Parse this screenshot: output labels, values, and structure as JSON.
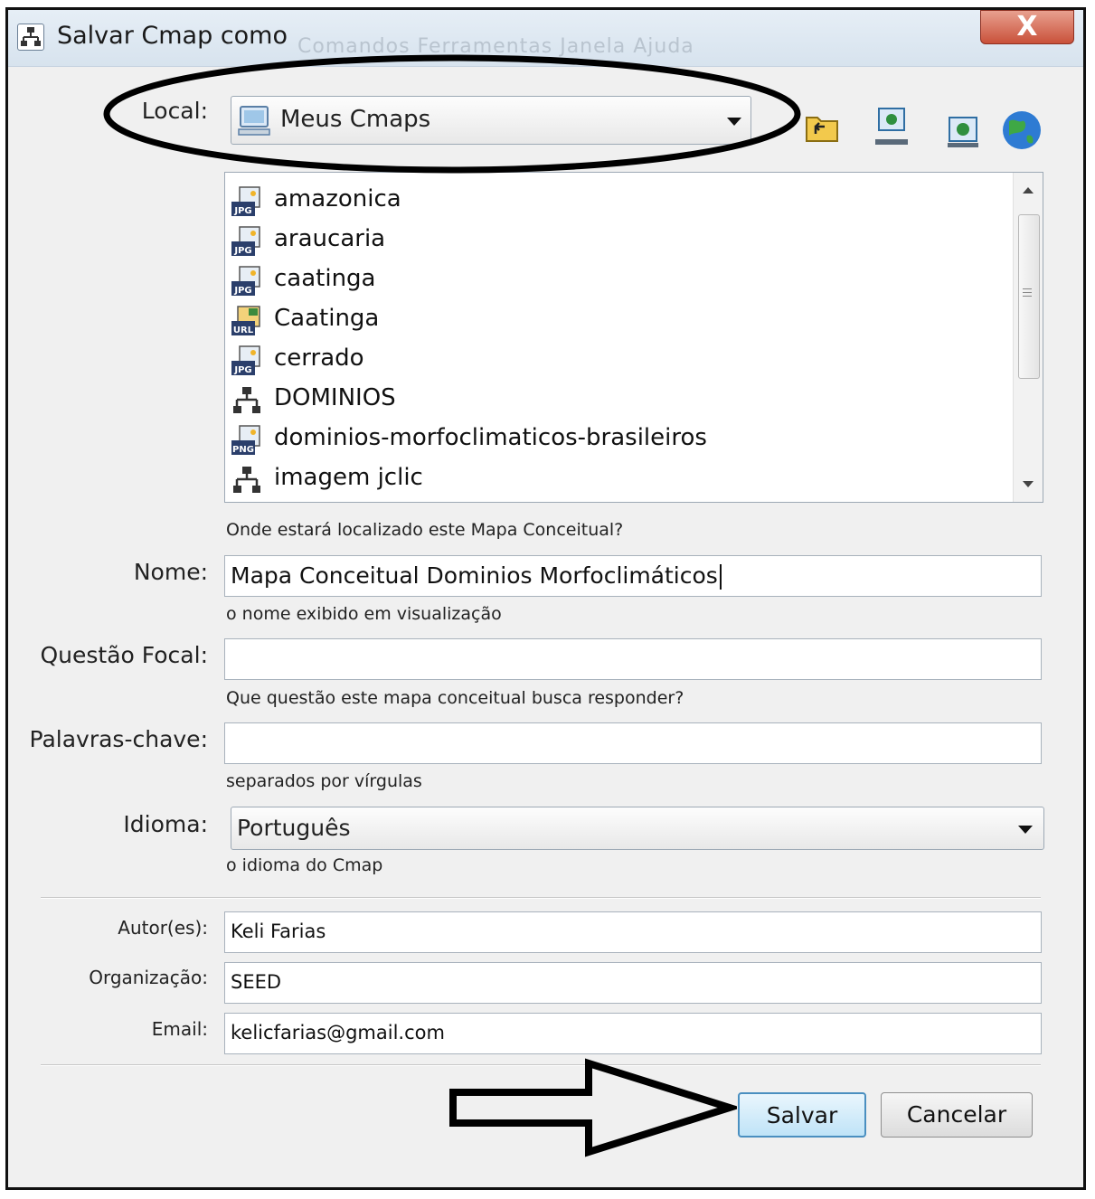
{
  "window": {
    "title": "Salvar Cmap como",
    "close_label": "X",
    "background_menu": "Comandos   Ferramentas   Janela   Ajuda"
  },
  "local": {
    "label": "Local:",
    "selected": "Meus Cmaps",
    "toolbar_icons": [
      "folder-up-icon",
      "computer-icon",
      "network-place-icon",
      "globe-icon"
    ]
  },
  "files": [
    {
      "name": "amazonica",
      "icon": "jpg-icon"
    },
    {
      "name": "araucaria",
      "icon": "jpg-icon"
    },
    {
      "name": "caatinga",
      "icon": "jpg-icon"
    },
    {
      "name": "Caatinga",
      "icon": "url-icon"
    },
    {
      "name": "cerrado",
      "icon": "jpg-icon"
    },
    {
      "name": "DOMINIOS",
      "icon": "cmap-icon"
    },
    {
      "name": "dominios-morfoclimaticos-brasileiros",
      "icon": "png-icon"
    },
    {
      "name": "imagem jclic",
      "icon": "cmap-icon"
    }
  ],
  "local_hint": "Onde estará localizado este Mapa Conceitual?",
  "nome": {
    "label": "Nome:",
    "value": "Mapa Conceitual Dominios Morfoclimáticos",
    "hint": "o nome exibido em visualização"
  },
  "questao": {
    "label": "Questão Focal:",
    "value": "",
    "hint": "Que questão este mapa conceitual busca responder?"
  },
  "palavras": {
    "label": "Palavras-chave:",
    "value": "",
    "hint": "separados por vírgulas"
  },
  "idioma": {
    "label": "Idioma:",
    "selected": "Português",
    "hint": "o idioma do Cmap"
  },
  "autor": {
    "label": "Autor(es):",
    "value": "Keli Farias"
  },
  "organizacao": {
    "label": "Organização:",
    "value": "SEED"
  },
  "email": {
    "label": "Email:",
    "value": "kelicfarias@gmail.com"
  },
  "buttons": {
    "save": "Salvar",
    "cancel": "Cancelar"
  },
  "colors": {
    "close": "#c9513a",
    "primary_border": "#4a8fc0",
    "annotation": "#000000"
  }
}
